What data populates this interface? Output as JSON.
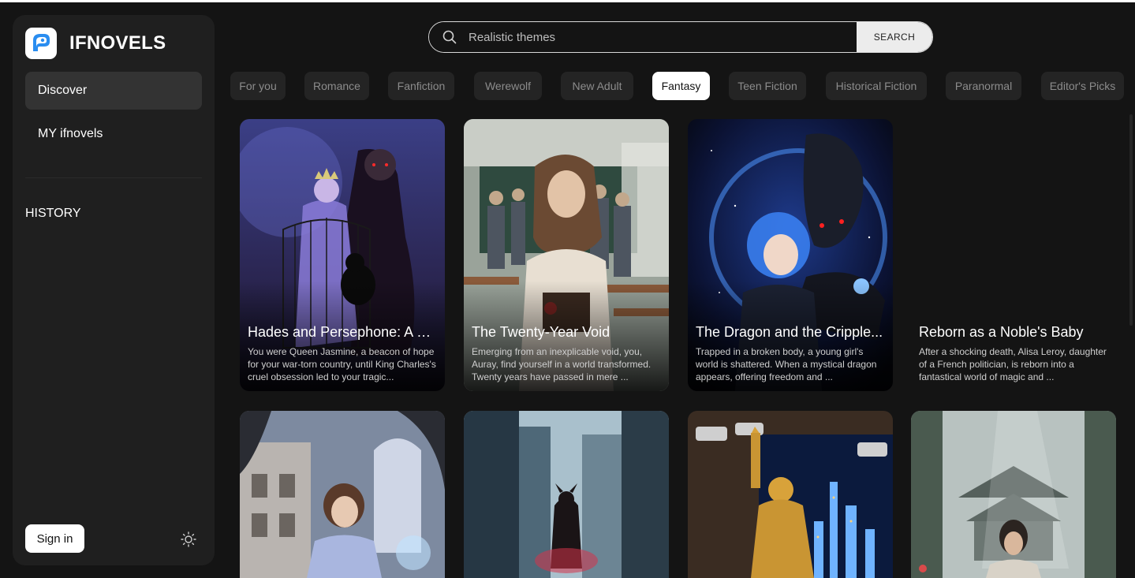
{
  "app": {
    "brand": "IFNOVELS"
  },
  "sidebar": {
    "items": [
      {
        "label": "Discover",
        "active": true
      },
      {
        "label": "MY ifnovels",
        "active": false
      }
    ],
    "history_label": "HISTORY",
    "signin_label": "Sign in",
    "theme_icon": "sun-icon"
  },
  "search": {
    "placeholder": "Realistic themes",
    "button_label": "SEARCH",
    "icon": "search-icon"
  },
  "categories": [
    {
      "label": "For you"
    },
    {
      "label": "Romance"
    },
    {
      "label": "Fanfiction"
    },
    {
      "label": "Werewolf"
    },
    {
      "label": "New Adult"
    },
    {
      "label": "Fantasy",
      "active": true
    },
    {
      "label": "Teen Fiction"
    },
    {
      "label": "Historical Fiction"
    },
    {
      "label": "Paranormal"
    },
    {
      "label": "Editor's Picks"
    }
  ],
  "books": [
    {
      "title": "Hades and Persephone: A D...",
      "description": "You were Queen Jasmine, a beacon of hope for your war-torn country, until King Charles's cruel obsession led to your tragic..."
    },
    {
      "title": "The Twenty-Year Void",
      "description": "Emerging from an inexplicable void, you, Auray, find yourself in a world transformed. Twenty years have passed in mere ..."
    },
    {
      "title": "The Dragon and the Cripple...",
      "description": "Trapped in a broken body, a young girl's world is shattered. When a mystical dragon appears, offering freedom and ..."
    },
    {
      "title": "Reborn as a Noble's Baby",
      "description": "After a shocking death, Alisa Leroy, daughter of a French politician, is reborn into a fantastical world of magic and ..."
    }
  ],
  "colors": {
    "background": "#141414",
    "sidebar": "#1f1f1f",
    "chip": "#242424",
    "active_chip": "#ffffff",
    "accent": "#4a8cf0"
  }
}
